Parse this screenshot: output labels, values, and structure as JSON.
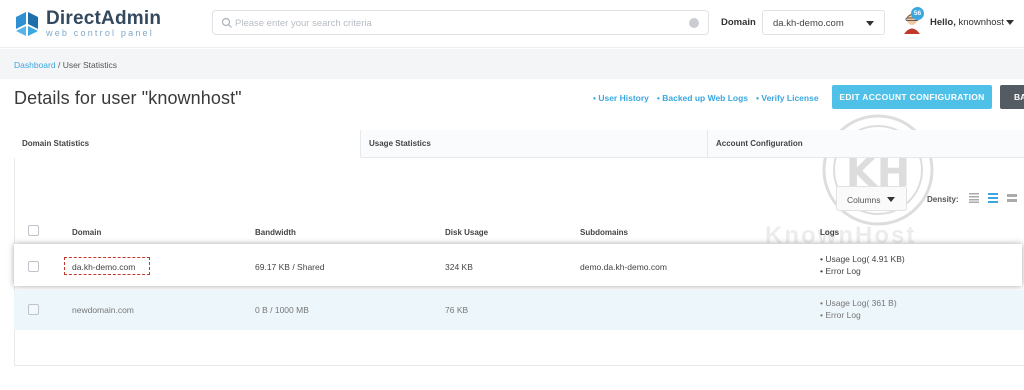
{
  "header": {
    "logo_title": "DirectAdmin",
    "logo_subtitle": "web control panel",
    "search_placeholder": "Please enter your search criteria",
    "domain_label": "Domain",
    "domain_value": "da.kh-demo.com",
    "notification_count": "56",
    "hello_prefix": "Hello,",
    "username": "knownhost"
  },
  "breadcrumb": {
    "home": "Dashboard",
    "separator": " / ",
    "current": "User Statistics"
  },
  "page": {
    "title": "Details for user \"knownhost\"",
    "links": [
      "• User History",
      "• Backed up Web Logs",
      "• Verify License"
    ],
    "edit_button": "EDIT ACCOUNT CONFIGURATION",
    "back_button": "BA"
  },
  "tabs": [
    "Domain Statistics",
    "Usage Statistics",
    "Account Configuration"
  ],
  "toolbar": {
    "columns_label": "Columns",
    "density_label": "Density:"
  },
  "table": {
    "columns": [
      "Domain",
      "Bandwidth",
      "Disk Usage",
      "Subdomains",
      "Logs"
    ],
    "rows": [
      {
        "domain": "da.kh-demo.com",
        "bandwidth": "69.17 KB / Shared",
        "disk": "324 KB",
        "subdomains": "demo.da.kh-demo.com",
        "logs": [
          "• Usage Log( 4.91 KB)",
          "• Error Log"
        ]
      },
      {
        "domain": "newdomain.com",
        "bandwidth": "0 B / 1000 MB",
        "disk": "76 KB",
        "subdomains": "",
        "logs": [
          "• Usage Log( 361 B)",
          "• Error Log"
        ]
      }
    ]
  },
  "watermark": {
    "mark": "KH",
    "text": "KnownHost"
  },
  "colors": {
    "accent": "#3aa7e0",
    "edit_button": "#4fc1e9",
    "back_button": "#545b62",
    "highlight_dash": "#c0392b",
    "row_alt": "#edf6fb"
  }
}
